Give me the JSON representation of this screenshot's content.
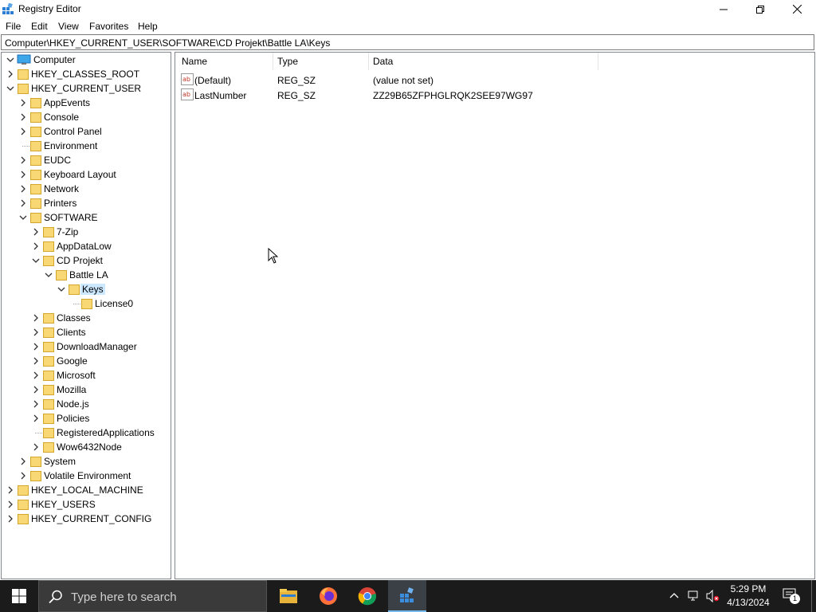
{
  "window": {
    "title": "Registry Editor"
  },
  "menu": [
    "File",
    "Edit",
    "View",
    "Favorites",
    "Help"
  ],
  "address": "Computer\\HKEY_CURRENT_USER\\SOFTWARE\\CD Projekt\\Battle LA\\Keys",
  "tree": {
    "root": "Computer",
    "items": [
      "HKEY_CLASSES_ROOT",
      "HKEY_CURRENT_USER",
      "AppEvents",
      "Console",
      "Control Panel",
      "Environment",
      "EUDC",
      "Keyboard Layout",
      "Network",
      "Printers",
      "SOFTWARE",
      "7-Zip",
      "AppDataLow",
      "CD Projekt",
      "Battle LA",
      "Keys",
      "License0",
      "Classes",
      "Clients",
      "DownloadManager",
      "Google",
      "Microsoft",
      "Mozilla",
      "Node.js",
      "Policies",
      "RegisteredApplications",
      "Wow6432Node",
      "System",
      "Volatile Environment",
      "HKEY_LOCAL_MACHINE",
      "HKEY_USERS",
      "HKEY_CURRENT_CONFIG"
    ],
    "selected": "Keys"
  },
  "list": {
    "columns": [
      "Name",
      "Type",
      "Data"
    ],
    "rows": [
      {
        "name": "(Default)",
        "type": "REG_SZ",
        "data": "(value not set)"
      },
      {
        "name": "LastNumber",
        "type": "REG_SZ",
        "data": "ZZ29B65ZFPHGLRQK2SEE97WG97"
      }
    ]
  },
  "taskbar": {
    "search_placeholder": "Type here to search",
    "time": "5:29 PM",
    "date": "4/13/2024",
    "notification_count": "1",
    "apps": [
      "file-explorer-icon",
      "firefox-icon",
      "chrome-icon",
      "registry-editor-icon"
    ]
  },
  "colors": {
    "selection": "#cce8ff",
    "taskbar": "#1b1b1b",
    "folder": "#f8d775"
  }
}
